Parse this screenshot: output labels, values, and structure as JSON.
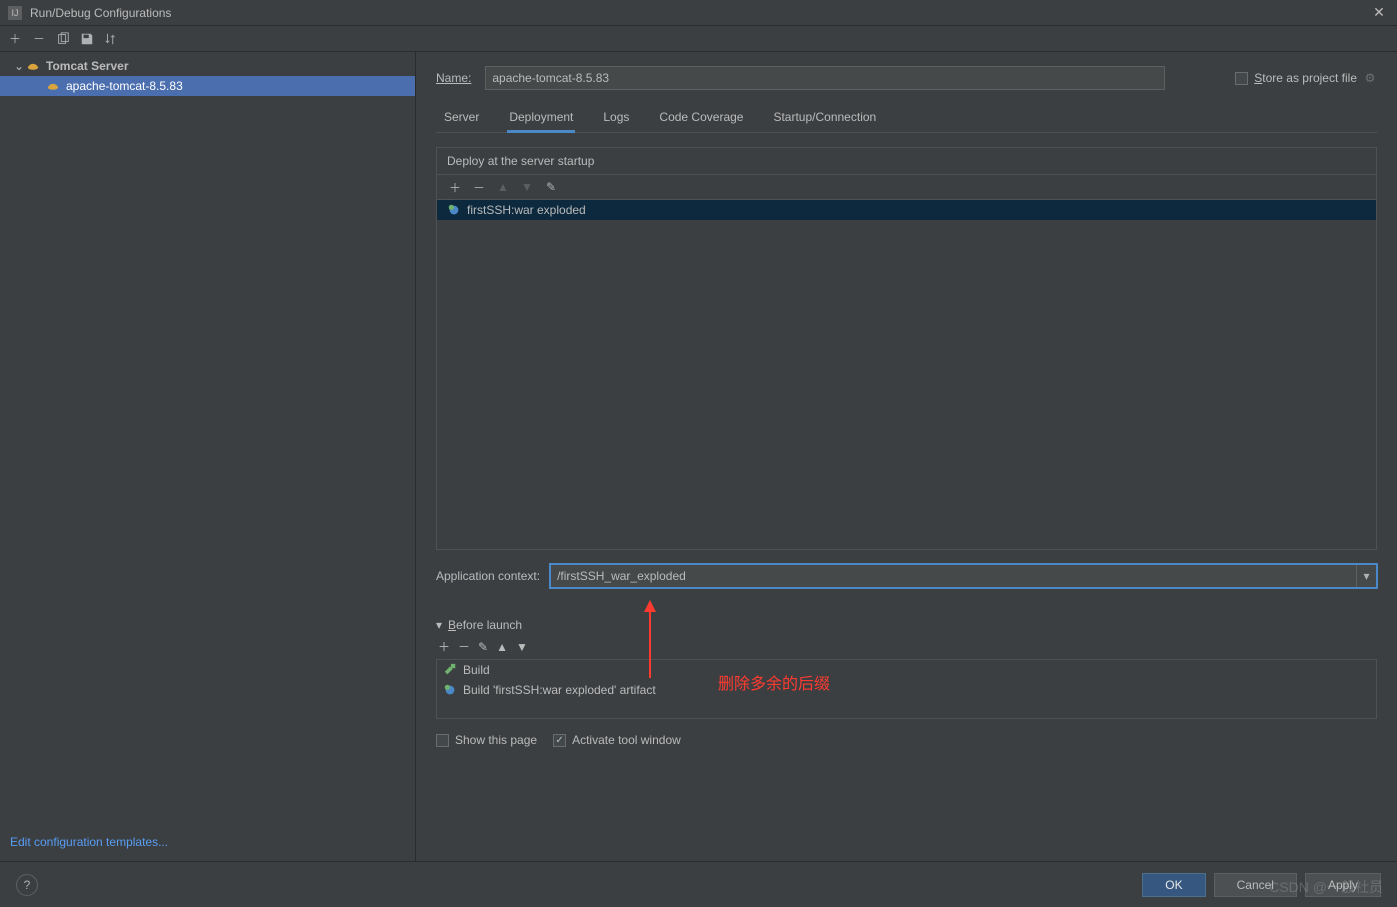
{
  "window": {
    "title": "Run/Debug Configurations"
  },
  "sidebar": {
    "group_label": "Tomcat Server",
    "items": [
      {
        "label": "apache-tomcat-8.5.83"
      }
    ],
    "edit_templates": "Edit configuration templates..."
  },
  "form": {
    "name_label": "Name:",
    "name_value": "apache-tomcat-8.5.83",
    "store_label": "Store as project file"
  },
  "tabs": {
    "items": [
      "Server",
      "Deployment",
      "Logs",
      "Code Coverage",
      "Startup/Connection"
    ],
    "active_index": 1
  },
  "deployment": {
    "section_title": "Deploy at the server startup",
    "artifacts": [
      {
        "label": "firstSSH:war exploded"
      }
    ],
    "app_context_label": "Application context:",
    "app_context_value": "/firstSSH_war_exploded"
  },
  "before_launch": {
    "title": "Before launch",
    "items": [
      {
        "icon": "hammer",
        "label": "Build"
      },
      {
        "icon": "artifact",
        "label": "Build 'firstSSH:war exploded' artifact"
      }
    ]
  },
  "checks": {
    "show_this_page": "Show this page",
    "activate_tool_window": "Activate tool window"
  },
  "footer": {
    "ok": "OK",
    "cancel": "Cancel",
    "apply": "Apply"
  },
  "annotation": {
    "text": "删除多余的后缀"
  },
  "watermark": "CSDN @一般社员"
}
